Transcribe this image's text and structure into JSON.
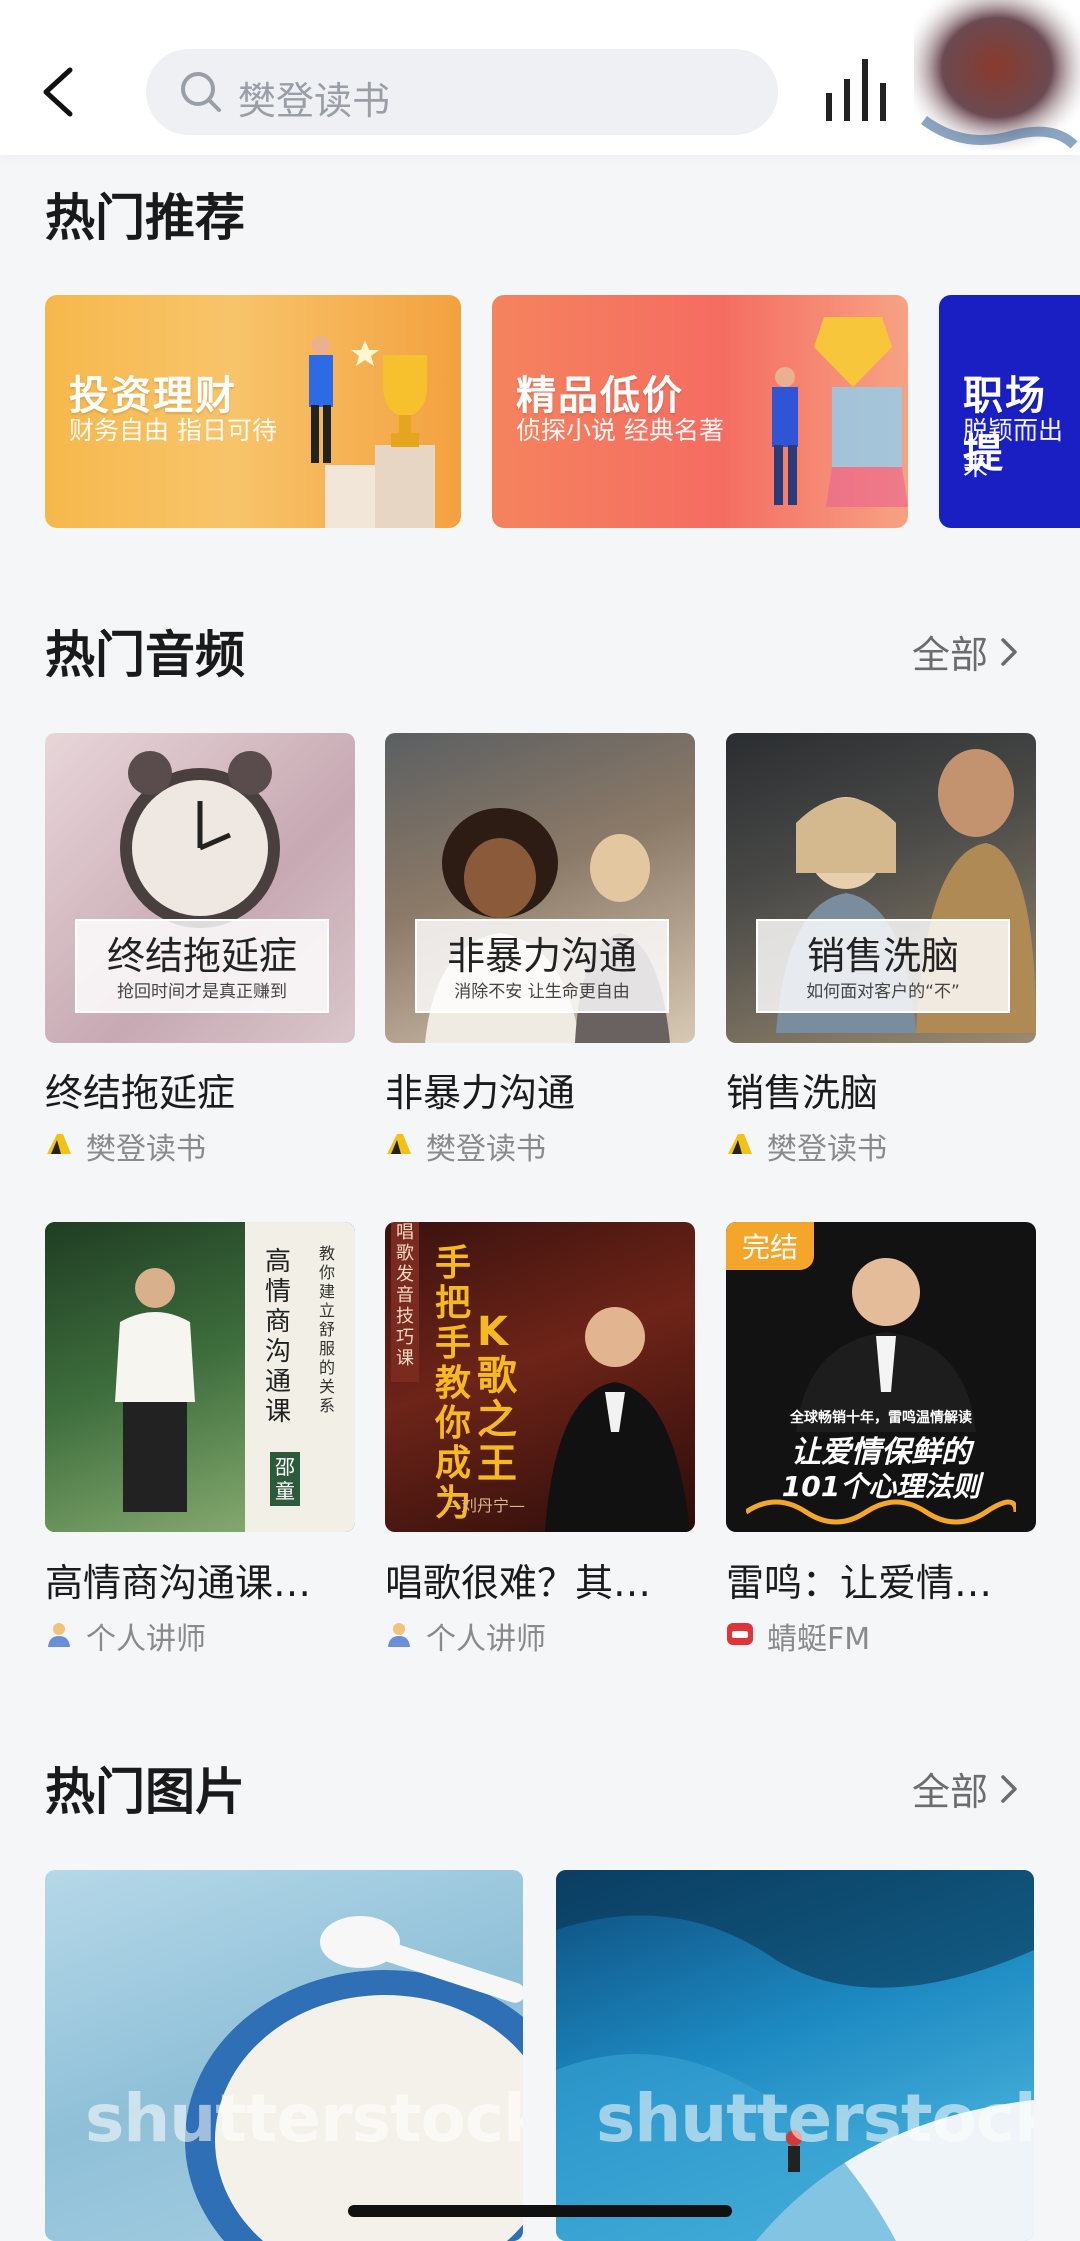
{
  "header": {
    "search_placeholder": "樊登读书"
  },
  "sections": {
    "recommend_title": "热门推荐",
    "audio_title": "热门音频",
    "audio_more": "全部",
    "images_title": "热门图片",
    "images_more": "全部"
  },
  "banners": [
    {
      "title": "投资理财",
      "subtitle": "财务自由 指日可待",
      "color": "#f7a24a"
    },
    {
      "title": "精品低价",
      "subtitle": "侦探小说 经典名著",
      "color": "#f26b5a"
    },
    {
      "title": "职场提",
      "subtitle": "脱颖而出 未",
      "color": "#1a1fc4"
    }
  ],
  "audio_items": [
    {
      "cover_title": "终结拖延症",
      "cover_subtitle": "抢回时间才是真正赚到",
      "title": "终结拖延症",
      "source": "樊登读书"
    },
    {
      "cover_title": "非暴力沟通",
      "cover_subtitle": "消除不安 让生命更自由",
      "title": "非暴力沟通",
      "source": "樊登读书"
    },
    {
      "cover_title": "销售洗脑",
      "cover_subtitle": "如何面对客户的“不”",
      "title": "销售洗脑",
      "source": "樊登读书"
    },
    {
      "cover_title": "高情商沟通课",
      "cover_side": "教你建立舒服的关系",
      "cover_author": "邵童",
      "title": "高情商沟通课…",
      "source": "个人讲师"
    },
    {
      "cover_title": "手把手教你成为",
      "cover_big": "K歌之王",
      "cover_side": "唱歌发音技巧课",
      "cover_author": "—刘丹宁—",
      "title": "唱歌很难？其…",
      "source": "个人讲师"
    },
    {
      "cover_badge": "完结",
      "cover_line1": "全球畅销十年，雷鸣温情解读",
      "cover_line2": "让爱情保鲜的",
      "cover_line3": "101个心理法则",
      "title": "雷鸣：让爱情…",
      "source": "蜻蜓FM"
    }
  ],
  "images": [
    {
      "watermark": "shutterstock"
    },
    {
      "watermark": "shutterstock"
    }
  ]
}
